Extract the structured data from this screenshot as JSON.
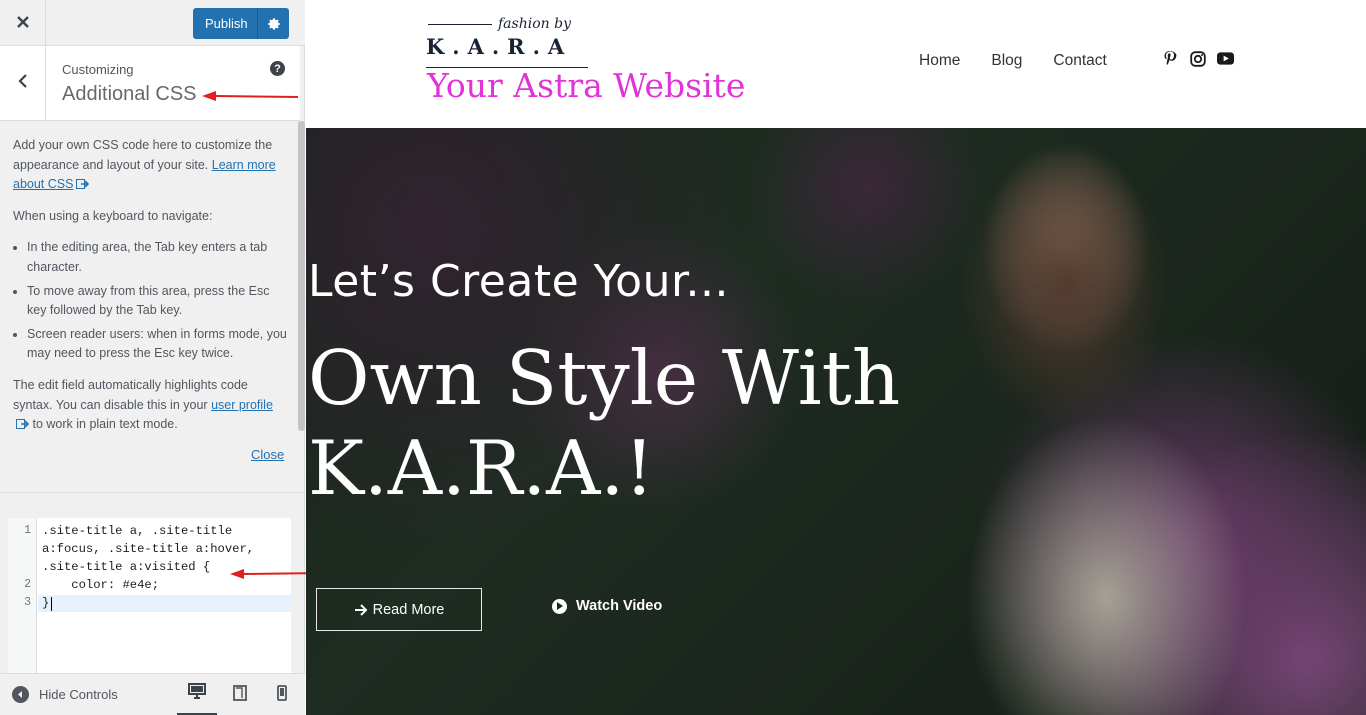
{
  "topbar": {
    "close_icon": "close-icon",
    "publish_label": "Publish",
    "settings_icon": "gear-icon"
  },
  "section": {
    "breadcrumb": "Customizing",
    "title": "Additional CSS",
    "help_icon": "help-icon"
  },
  "description": {
    "p1_text": "Add your own CSS code here to customize the appearance and layout of your site.",
    "p1_link": "Learn more about CSS",
    "p2": "When using a keyboard to navigate:",
    "bullets": [
      "In the editing area, the Tab key enters a tab character.",
      "To move away from this area, press the Esc key followed by the Tab key.",
      "Screen reader users: when in forms mode, you may need to press the Esc key twice."
    ],
    "p3_before": "The edit field automatically highlights code syntax. You can disable this in your",
    "p3_link": "user profile",
    "p3_after": "to work in plain text mode.",
    "close_link": "Close"
  },
  "editor": {
    "line_numbers": [
      "1",
      "2",
      "3"
    ],
    "lines": [
      ".site-title a, .site-title",
      "a:focus, .site-title a:hover,",
      ".site-title a:visited {",
      "    color: #e4e;",
      "}"
    ]
  },
  "footer": {
    "hide_controls": "Hide Controls",
    "devices": [
      "desktop",
      "tablet",
      "mobile"
    ]
  },
  "preview": {
    "logo": {
      "script": "fashion by",
      "wordmark": "K.A.R.A"
    },
    "site_title": "Your Astra Website",
    "nav": [
      "Home",
      "Blog",
      "Contact"
    ],
    "social": [
      "pinterest-icon",
      "instagram-icon",
      "youtube-icon"
    ],
    "hero": {
      "subtitle": "Let’s Create Your...",
      "title_line1": "Own Style With",
      "title_line2": "K.A.R.A.!",
      "read_more": "Read More",
      "watch_video": "Watch Video"
    }
  },
  "colors": {
    "accent": "#2271b1",
    "site_title": "#e233d8",
    "annotation": "#e0201f"
  }
}
